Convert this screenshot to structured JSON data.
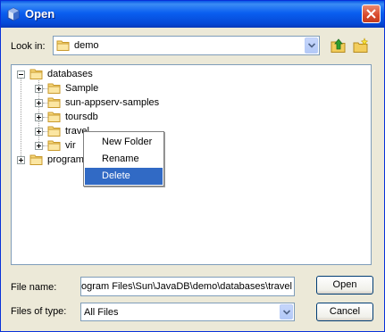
{
  "window": {
    "title": "Open"
  },
  "lookin": {
    "label": "Look in:",
    "value": "demo"
  },
  "tree": {
    "root": "databases",
    "children": [
      "Sample",
      "sun-appserv-samples",
      "toursdb",
      "travel",
      "vir"
    ],
    "sibling": "program"
  },
  "context_menu": {
    "items": [
      "New Folder",
      "Rename",
      "Delete"
    ],
    "selected": "Delete"
  },
  "filename": {
    "label": "File name:",
    "value": "ogram Files\\Sun\\JavaDB\\demo\\databases\\travel"
  },
  "filetype": {
    "label": "Files of type:",
    "value": "All Files"
  },
  "buttons": {
    "open": "Open",
    "cancel": "Cancel"
  },
  "icons": {
    "title": "java-cup-icon",
    "up": "up-folder-icon",
    "new": "new-folder-icon",
    "close": "close-icon",
    "folder": "folder-icon",
    "dropdown": "chevron-down-icon"
  },
  "colors": {
    "selection": "#316ac5",
    "titlebar": "#0a5ff0",
    "close": "#d9482a"
  }
}
